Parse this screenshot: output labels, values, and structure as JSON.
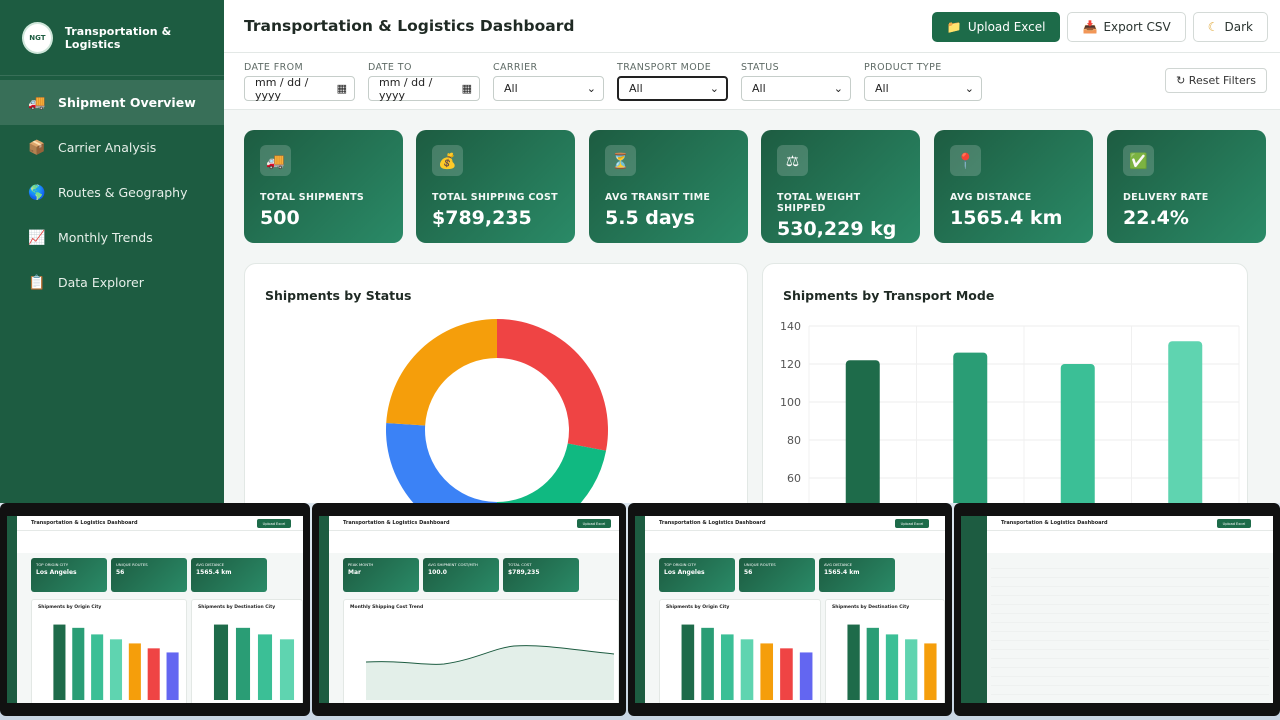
{
  "sidebar": {
    "brand_logo_text": "NGT",
    "brand_name": "Transportation & Logistics",
    "items": [
      {
        "label": "Shipment Overview",
        "icon": "truck-icon",
        "active": true
      },
      {
        "label": "Carrier Analysis",
        "icon": "package-icon"
      },
      {
        "label": "Routes & Geography",
        "icon": "globe-icon"
      },
      {
        "label": "Monthly Trends",
        "icon": "chart-icon"
      },
      {
        "label": "Data Explorer",
        "icon": "clipboard-icon"
      }
    ]
  },
  "header": {
    "title": "Transportation & Logistics Dashboard",
    "upload_label": "Upload Excel",
    "export_label": "Export CSV",
    "theme_label": "Dark"
  },
  "filters": {
    "date_from_label": "DATE FROM",
    "date_from_value": "mm / dd / yyyy",
    "date_to_label": "DATE TO",
    "date_to_value": "mm / dd / yyyy",
    "carrier_label": "CARRIER",
    "carrier_value": "All",
    "mode_label": "TRANSPORT MODE",
    "mode_value": "All",
    "status_label": "STATUS",
    "status_value": "All",
    "product_label": "PRODUCT TYPE",
    "product_value": "All",
    "reset_label": "↻ Reset Filters"
  },
  "kpis": [
    {
      "label": "TOTAL SHIPMENTS",
      "value": "500",
      "icon": "truck-icon"
    },
    {
      "label": "TOTAL SHIPPING COST",
      "value": "$789,235",
      "icon": "money-bag-icon"
    },
    {
      "label": "AVG TRANSIT TIME",
      "value": "5.5 days",
      "icon": "hourglass-icon"
    },
    {
      "label": "TOTAL WEIGHT SHIPPED",
      "value": "530,229 kg",
      "icon": "scale-icon"
    },
    {
      "label": "AVG DISTANCE",
      "value": "1565.4 km",
      "icon": "pin-icon"
    },
    {
      "label": "DELIVERY RATE",
      "value": "22.4%",
      "icon": "check-icon"
    }
  ],
  "charts": {
    "status_title": "Shipments by Status",
    "mode_title": "Shipments by Transport Mode"
  },
  "chart_data": [
    {
      "type": "pie",
      "title": "Shipments by Status",
      "slices": [
        {
          "value": 28,
          "color": "#ef4444"
        },
        {
          "value": 22,
          "color": "#10b981"
        },
        {
          "value": 26,
          "color": "#3b82f6"
        },
        {
          "value": 24,
          "color": "#f59e0b"
        }
      ]
    },
    {
      "type": "bar",
      "title": "Shipments by Transport Mode",
      "values": [
        122,
        126,
        120,
        132
      ],
      "colors": [
        "#1e6b4a",
        "#2a9d75",
        "#3bbf96",
        "#5fd4b0"
      ],
      "ylim": [
        40,
        140
      ],
      "yticks": [
        140,
        120,
        100,
        80,
        60,
        40
      ],
      "grid": true
    }
  ],
  "thumbnails": [
    {
      "title": "Transportation & Logistics Dashboard",
      "button": "Upload Excel",
      "kpi1_label": "TOP ORIGIN CITY",
      "kpi1_value": "Los Angeles",
      "kpi2_label": "UNIQUE ROUTES",
      "kpi2_value": "56",
      "kpi3_label": "AVG DISTANCE",
      "kpi3_value": "1565.4 km",
      "chart1": "Shipments by Origin City",
      "chart2": "Shipments by Destination City"
    },
    {
      "title": "Transportation & Logistics Dashboard",
      "button": "Upload Excel",
      "kpi1_label": "PEAK MONTH",
      "kpi1_value": "Mar",
      "kpi2_label": "AVG SHIPMENT COST/MTH",
      "kpi2_value": "100.0",
      "kpi3_label": "TOTAL COST",
      "kpi3_value": "$789,235",
      "chart1": "Monthly Shipping Cost Trend",
      "chart2": ""
    },
    {
      "title": "Transportation & Logistics Dashboard",
      "button": "Upload Excel",
      "kpi1_label": "TOP ORIGIN CITY",
      "kpi1_value": "Los Angeles",
      "kpi2_label": "UNIQUE ROUTES",
      "kpi2_value": "56",
      "kpi3_label": "AVG DISTANCE",
      "kpi3_value": "1565.4 km",
      "chart1": "Shipments by Origin City",
      "chart2": "Shipments by Destination City"
    },
    {
      "title": "Transportation & Logistics Dashboard",
      "button": "Upload Excel",
      "kpi1_label": "",
      "kpi1_value": "",
      "kpi2_label": "",
      "kpi2_value": "",
      "kpi3_label": "",
      "kpi3_value": "",
      "chart1": "",
      "chart2": ""
    }
  ]
}
